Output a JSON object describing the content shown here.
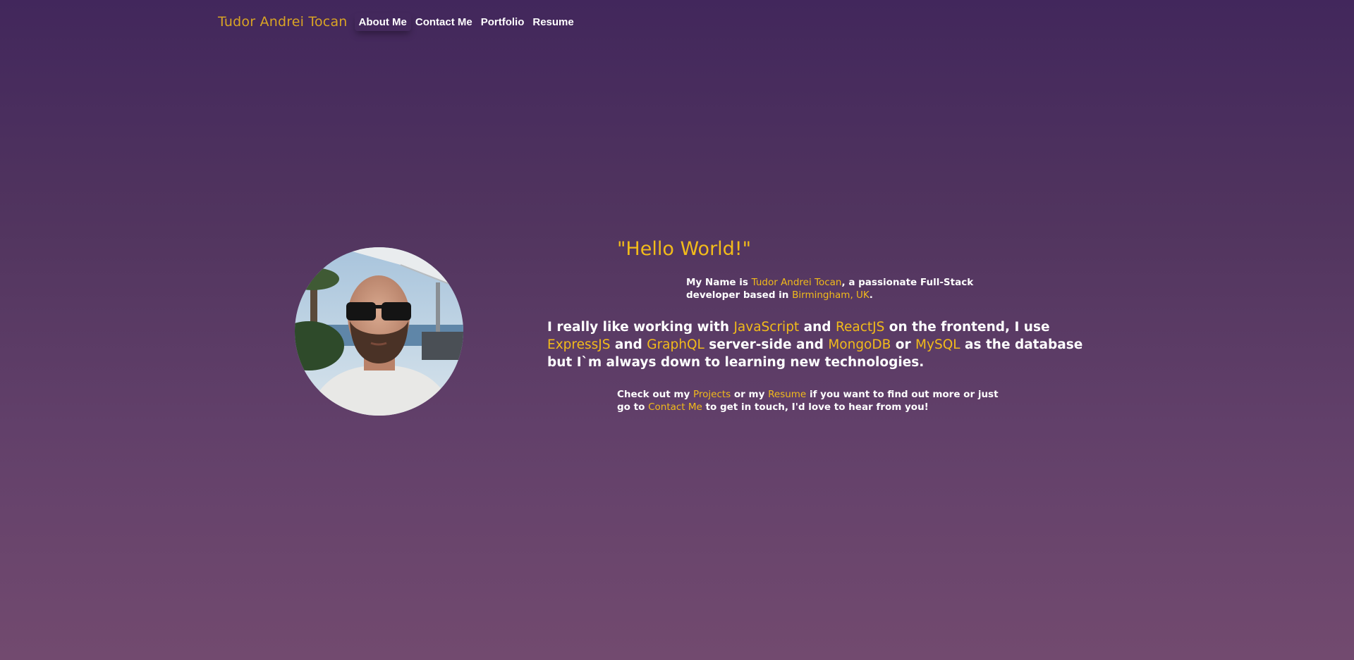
{
  "nav": {
    "brand": "Tudor Andrei Tocan",
    "links": [
      {
        "label": "About Me",
        "active": true
      },
      {
        "label": "Contact Me",
        "active": false
      },
      {
        "label": "Portfolio",
        "active": false
      },
      {
        "label": "Resume",
        "active": false
      }
    ]
  },
  "colors": {
    "accent": "#f2bb1a",
    "brand": "#d9a424",
    "text": "#ffffff",
    "background_top": "#42275c",
    "background_bottom": "#724a6f"
  },
  "hero": {
    "greeting": "\"Hello World!\"",
    "intro": {
      "prefix": "My Name is ",
      "name": "Tudor Andrei Tocan",
      "middle": ", a passionate Full-Stack developer based in ",
      "location": "Birmingham, UK",
      "suffix": "."
    },
    "skills": {
      "t1": "I really like working with ",
      "js": "JavaScript",
      "t2": " and ",
      "react": "ReactJS",
      "t3": " on the frontend, I use ",
      "express": "ExpressJS",
      "t4": " and ",
      "graphql": "GraphQL",
      "t5": " server-side and ",
      "mongodb": "MongoDB",
      "t6": " or ",
      "mysql": "MySQL",
      "t7": " as the database but I`m always down to learning new technologies."
    },
    "cta": {
      "t1": "Check out my ",
      "projects": "Projects",
      "t2": " or my ",
      "resume": "Resume",
      "t3": " if you want to find out more or just go to ",
      "contact": "Contact Me",
      "t4": " to get in touch, I'd love to hear from you!"
    }
  }
}
